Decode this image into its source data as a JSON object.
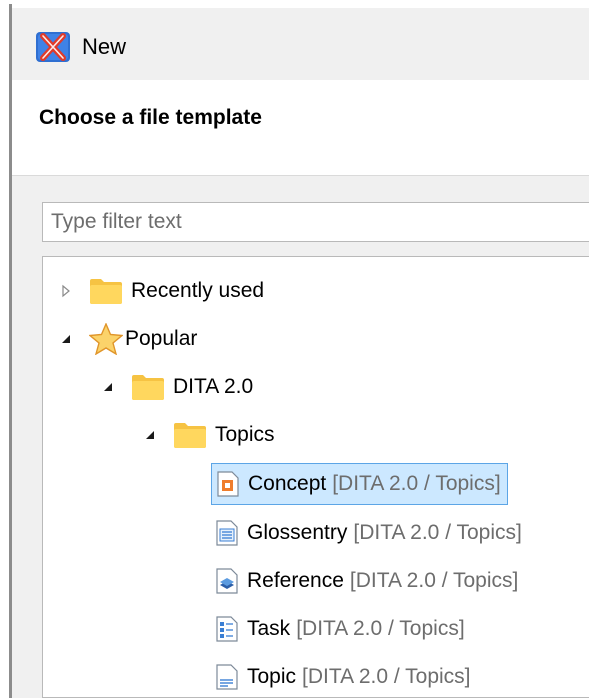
{
  "window": {
    "title": "New"
  },
  "header": {
    "title": "Choose a file template"
  },
  "filter": {
    "placeholder": "Type filter text",
    "value": ""
  },
  "tree": {
    "recently_used": {
      "label": "Recently used",
      "expanded": false
    },
    "popular": {
      "label": "Popular",
      "expanded": true
    },
    "dita": {
      "label": "DITA 2.0",
      "expanded": true
    },
    "topics": {
      "label": "Topics",
      "expanded": true
    },
    "templates": [
      {
        "label": "Concept",
        "path": "[DITA 2.0 / Topics]",
        "icon": "concept-icon",
        "selected": true
      },
      {
        "label": "Glossentry",
        "path": "[DITA 2.0 / Topics]",
        "icon": "glossentry-icon",
        "selected": false
      },
      {
        "label": "Reference",
        "path": "[DITA 2.0 / Topics]",
        "icon": "reference-icon",
        "selected": false
      },
      {
        "label": "Task",
        "path": "[DITA 2.0 / Topics]",
        "icon": "task-icon",
        "selected": false
      },
      {
        "label": "Topic",
        "path": "[DITA 2.0 / Topics]",
        "icon": "topic-icon",
        "selected": false
      }
    ]
  },
  "colors": {
    "selection_bg": "#cce8ff",
    "selection_border": "#5ca5e6",
    "folder": "#ffd45c",
    "star": "#f5a623",
    "path_text": "#6d6d6d"
  }
}
